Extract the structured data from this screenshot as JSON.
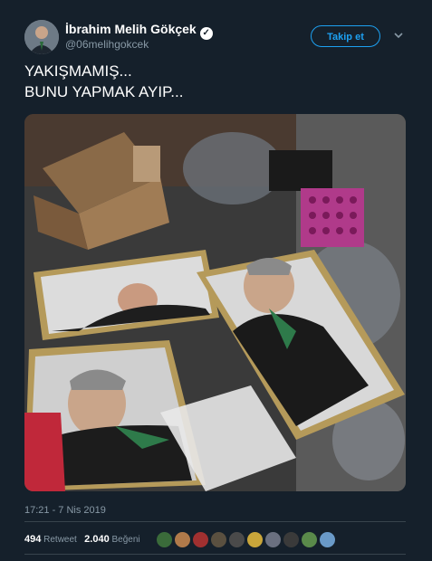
{
  "user": {
    "name": "İbrahim Melih Gökçek",
    "handle": "@06melihgokcek",
    "verified": true
  },
  "follow_label": "Takip et",
  "tweet": {
    "line1": "YAKIŞMAMIŞ...",
    "line2": "BUNU YAPMAK AYIP..."
  },
  "timestamp": "17:21 - 7 Nis 2019",
  "stats": {
    "retweets": "494",
    "retweets_label": "Retweet",
    "likes": "2.040",
    "likes_label": "Beğeni"
  },
  "likers": [
    "#3a6b3a",
    "#b07a4a",
    "#a03030",
    "#5a5040",
    "#4a4a4a",
    "#c9a63a",
    "#6a7080",
    "#3a3a3a",
    "#5a8a4a",
    "#6a9ac8"
  ],
  "colors": {
    "background": "#15202b",
    "accent": "#1da1f2",
    "secondary_text": "#8899a6",
    "divider": "#38444d"
  },
  "icons": {
    "verified": "verified-badge-icon",
    "menu": "chevron-down-icon"
  }
}
